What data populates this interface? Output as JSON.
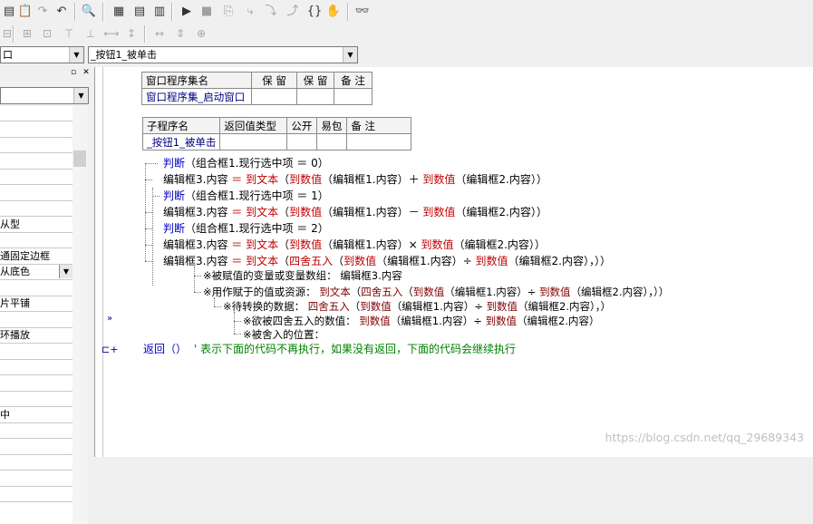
{
  "window_combo": {
    "value": "口"
  },
  "event_combo": {
    "value": "_按钮1_被单击"
  },
  "left_panel": {
    "rows": [
      "",
      "",
      "",
      "",
      "",
      "",
      "",
      "从型",
      "",
      "通固定边框",
      "从底色",
      "",
      "片平铺",
      "",
      "环播放",
      "",
      "",
      "",
      "",
      "中",
      "",
      "",
      "",
      "",
      ""
    ]
  },
  "class_table": {
    "headers": [
      "窗口程序集名",
      "保 留",
      "保 留",
      "备 注"
    ],
    "row": [
      "窗口程序集_启动窗口",
      "",
      "",
      ""
    ]
  },
  "sub_table": {
    "headers": [
      "子程序名",
      "返回值类型",
      "公开",
      "易包",
      "备 注"
    ],
    "row": [
      "_按钮1_被单击",
      "",
      "",
      "",
      ""
    ]
  },
  "code": {
    "l1": {
      "kw": "判断",
      "rest": "（组合框1.现行选中项 ＝ 0）"
    },
    "l2": {
      "a": "编辑框3.内容 ",
      "eq": "＝ ",
      "f1": "到文本",
      "b": "（",
      "f2": "到数值",
      "c": "（编辑框1.内容）＋ ",
      "f3": "到数值",
      "d": "（编辑框2.内容））"
    },
    "l3": {
      "kw": "判断",
      "rest": "（组合框1.现行选中项 ＝ 1）"
    },
    "l4": {
      "a": "编辑框3.内容 ",
      "eq": "＝ ",
      "f1": "到文本",
      "b": "（",
      "f2": "到数值",
      "c": "（编辑框1.内容）－ ",
      "f3": "到数值",
      "d": "（编辑框2.内容））"
    },
    "l5": {
      "kw": "判断",
      "rest": "（组合框1.现行选中项 ＝ 2）"
    },
    "l6": {
      "a": "编辑框3.内容 ",
      "eq": "＝ ",
      "f1": "到文本",
      "b": "（",
      "f2": "到数值",
      "c": "（编辑框1.内容）× ",
      "f3": "到数值",
      "d": "（编辑框2.内容））"
    },
    "l7": {
      "a": "编辑框3.内容 ",
      "eq": "＝ ",
      "f1": "到文本",
      "b": "（",
      "f4": "四舍五入",
      "b2": "（",
      "f2": "到数值",
      "c": "（编辑框1.内容）÷ ",
      "f3": "到数值",
      "d": "（编辑框2.内容），））"
    },
    "p1": "※被赋值的变量或变量数组： 编辑框3.内容",
    "p2": {
      "a": "※用作赋于的值或资源： ",
      "f1": "到文本",
      "b": "（",
      "f4": "四舍五入",
      "b2": "（",
      "f2": "到数值",
      "c": "（编辑框1.内容）÷ ",
      "f3": "到数值",
      "d": "（编辑框2.内容），））"
    },
    "p3": {
      "a": "※待转换的数据： ",
      "f4": "四舍五入",
      "b": "（",
      "f2": "到数值",
      "c": "（编辑框1.内容）÷ ",
      "f3": "到数值",
      "d": "（编辑框2.内容），）"
    },
    "p4": {
      "a": "※欲被四舍五入的数值： ",
      "f2": "到数值",
      "c": "（编辑框1.内容）÷ ",
      "f3": "到数值",
      "d": "（编辑框2.内容）"
    },
    "p5": "※被舍入的位置：",
    "ret": {
      "kw": "返回",
      "paren": "（）",
      "comment": "' 表示下面的代码不再执行，如果没有返回，下面的代码会继续执行"
    }
  },
  "gutter_marker": "»",
  "watermark": "https://blog.csdn.net/qq_29689343"
}
